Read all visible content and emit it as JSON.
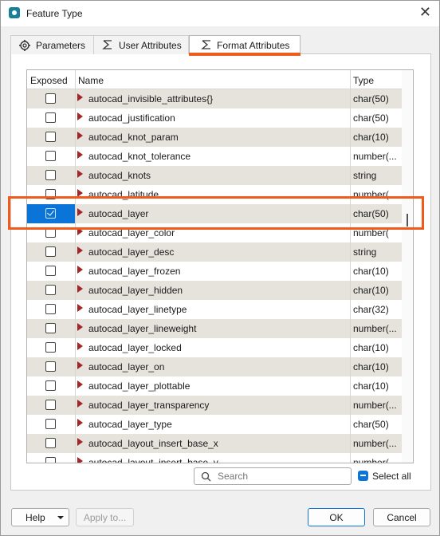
{
  "window": {
    "title": "Feature Type",
    "close_label": "✕"
  },
  "tabs": [
    {
      "label": "Parameters",
      "icon": "gear-icon"
    },
    {
      "label": "User Attributes",
      "icon": "sigma-icon"
    },
    {
      "label": "Format Attributes",
      "icon": "sigma-icon",
      "active": true
    }
  ],
  "grid": {
    "columns": {
      "exposed": "Exposed",
      "name": "Name",
      "type": "Type"
    },
    "rows": [
      {
        "exposed": false,
        "name": "autocad_invisible_attributes{}",
        "type": "char(50)"
      },
      {
        "exposed": false,
        "name": "autocad_justification",
        "type": "char(50)"
      },
      {
        "exposed": false,
        "name": "autocad_knot_param",
        "type": "char(10)"
      },
      {
        "exposed": false,
        "name": "autocad_knot_tolerance",
        "type": "number(..."
      },
      {
        "exposed": false,
        "name": "autocad_knots",
        "type": "string"
      },
      {
        "exposed": false,
        "name": "autocad_latitude",
        "type": "number("
      },
      {
        "exposed": true,
        "name": "autocad_layer",
        "type": "char(50)",
        "selected": true
      },
      {
        "exposed": false,
        "name": "autocad_layer_color",
        "type": "number("
      },
      {
        "exposed": false,
        "name": "autocad_layer_desc",
        "type": "string"
      },
      {
        "exposed": false,
        "name": "autocad_layer_frozen",
        "type": "char(10)"
      },
      {
        "exposed": false,
        "name": "autocad_layer_hidden",
        "type": "char(10)"
      },
      {
        "exposed": false,
        "name": "autocad_layer_linetype",
        "type": "char(32)"
      },
      {
        "exposed": false,
        "name": "autocad_layer_lineweight",
        "type": "number(..."
      },
      {
        "exposed": false,
        "name": "autocad_layer_locked",
        "type": "char(10)"
      },
      {
        "exposed": false,
        "name": "autocad_layer_on",
        "type": "char(10)"
      },
      {
        "exposed": false,
        "name": "autocad_layer_plottable",
        "type": "char(10)"
      },
      {
        "exposed": false,
        "name": "autocad_layer_transparency",
        "type": "number(..."
      },
      {
        "exposed": false,
        "name": "autocad_layer_type",
        "type": "char(50)"
      },
      {
        "exposed": false,
        "name": "autocad_layout_insert_base_x",
        "type": "number(..."
      },
      {
        "exposed": false,
        "name": "autocad_layout_insert_base_y",
        "type": "number("
      }
    ]
  },
  "search": {
    "placeholder": "Search"
  },
  "select_all": {
    "label": "Select all"
  },
  "footer": {
    "help_label": "Help",
    "apply_label": "Apply to...",
    "ok_label": "OK",
    "cancel_label": "Cancel"
  },
  "colors": {
    "accent_highlight": "#f05a1a",
    "selection": "#0a74d9",
    "row_alt": "#e6e3dd",
    "row_arrow": "#a3252a"
  }
}
